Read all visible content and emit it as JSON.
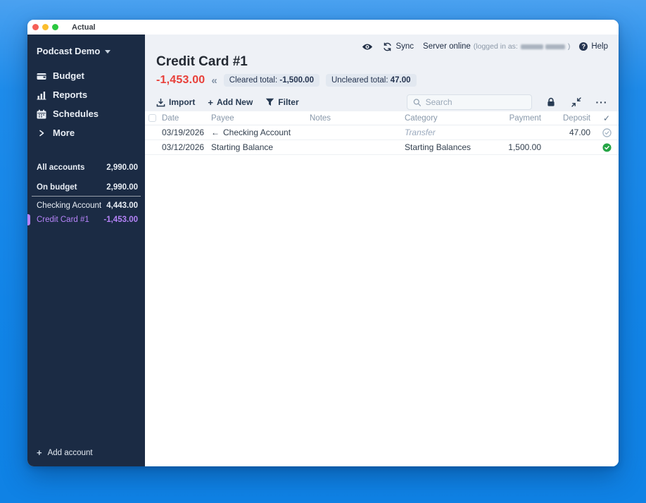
{
  "window": {
    "title": "Actual"
  },
  "icons": {
    "plus": "+",
    "double_chevron_left": "«",
    "transfer_arrow": "←",
    "dots": "···",
    "check": "✓",
    "question_mark": "?"
  },
  "sidebar": {
    "budget_name": "Podcast Demo",
    "nav": [
      {
        "label": "Budget",
        "icon": "wallet-icon"
      },
      {
        "label": "Reports",
        "icon": "bar-chart-icon"
      },
      {
        "label": "Schedules",
        "icon": "calendar-icon"
      },
      {
        "label": "More",
        "icon": "chevron-right-icon"
      }
    ],
    "summary": [
      {
        "label": "All accounts",
        "value": "2,990.00"
      },
      {
        "label": "On budget",
        "value": "2,990.00"
      }
    ],
    "accounts": [
      {
        "name": "Checking Account",
        "value": "4,443.00",
        "selected": false
      },
      {
        "name": "Credit Card #1",
        "value": "-1,453.00",
        "selected": true
      }
    ],
    "add_account_label": "Add account"
  },
  "topbar": {
    "sync_label": "Sync",
    "server_status": "Server online",
    "logged_in_prefix": "(logged in as:",
    "logged_in_suffix": ")",
    "help_label": "Help"
  },
  "header": {
    "account_title": "Credit Card #1",
    "balance": "-1,453.00",
    "cleared_label": "Cleared total:",
    "cleared_value": "-1,500.00",
    "uncleared_label": "Uncleared total:",
    "uncleared_value": "47.00"
  },
  "toolbar": {
    "import_label": "Import",
    "add_new_label": "Add New",
    "filter_label": "Filter",
    "search_placeholder": "Search"
  },
  "table": {
    "columns": [
      "Date",
      "Payee",
      "Notes",
      "Category",
      "Payment",
      "Deposit"
    ],
    "rows": [
      {
        "date": "03/19/2026",
        "payee": "Checking Account",
        "notes": "",
        "category": "Transfer",
        "payment": "",
        "deposit": "47.00",
        "status": "uncleared"
      },
      {
        "date": "03/12/2026",
        "payee": "Starting Balance",
        "notes": "",
        "category": "Starting Balances",
        "payment": "1,500.00",
        "deposit": "",
        "status": "cleared"
      }
    ]
  },
  "colors": {
    "accent_purple": "#b583f8",
    "negative_red": "#e8403a",
    "cleared_green": "#26a546",
    "uncleared_gray": "#a6b6c6",
    "sidebar_bg": "#1b2b44",
    "header_bg": "#eef1f6",
    "badge_bg": "#e2e8f0",
    "desktop_blue": "#1285e8"
  }
}
